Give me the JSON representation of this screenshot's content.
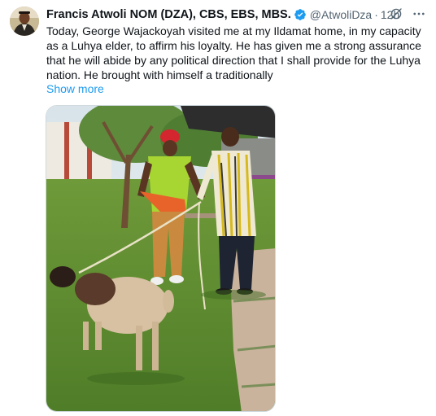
{
  "author": {
    "display_name": "Francis Atwoli NOM (DZA), CBS, EBS, MBS.",
    "handle": "@AtwoliDza",
    "separator": "·",
    "time": "12h",
    "verified": true
  },
  "body_lines": [
    "Today, George Wajackoyah visited me at my Ildamat home, in my capacity",
    "as a Luhya elder, to affirm his loyalty. He has given me a strong assurance",
    "that he will abide by any political direction that I shall provide for the Luhya",
    "nation. He brought with himself a traditionally"
  ],
  "show_more_label": "Show more",
  "icons": {
    "verified": "verified-badge-icon",
    "grok": "grok-icon",
    "more": "more-options-icon"
  },
  "colors": {
    "link": "#1d9bf0",
    "secondary_text": "#536471",
    "verified": "#1d9bf0"
  }
}
